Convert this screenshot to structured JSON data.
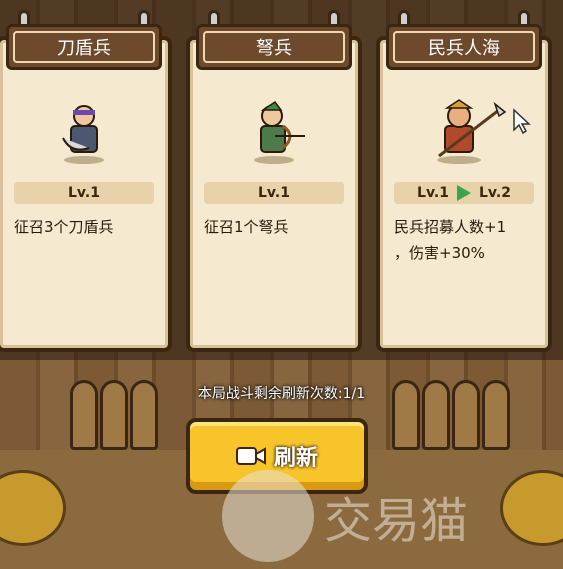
{
  "cards": [
    {
      "title": "刀盾兵",
      "level": "Lv.1",
      "description": "征召3个刀盾兵",
      "portrait": "shield-soldier-icon"
    },
    {
      "title": "弩兵",
      "level": "Lv.1",
      "description": "征召1个弩兵",
      "portrait": "crossbowman-icon"
    },
    {
      "title": "民兵人海",
      "level": "Lv.1",
      "level_next": "Lv.2",
      "description_line1": "民兵招募人数+1",
      "description_line2": "，伤害+30%",
      "portrait": "militia-general-icon"
    }
  ],
  "remaining_refresh_text": "本局战斗剩余刷新次数:1/1",
  "refresh_button": {
    "label": "刷新",
    "icon": "video-camera-icon"
  },
  "watermark": {
    "text": "交易猫"
  },
  "colors": {
    "card_bg": "#f5e9cf",
    "title_bg": "#6e4a2c",
    "button_yellow": "#f7c52a",
    "upgrade_arrow": "#3aa54a"
  }
}
